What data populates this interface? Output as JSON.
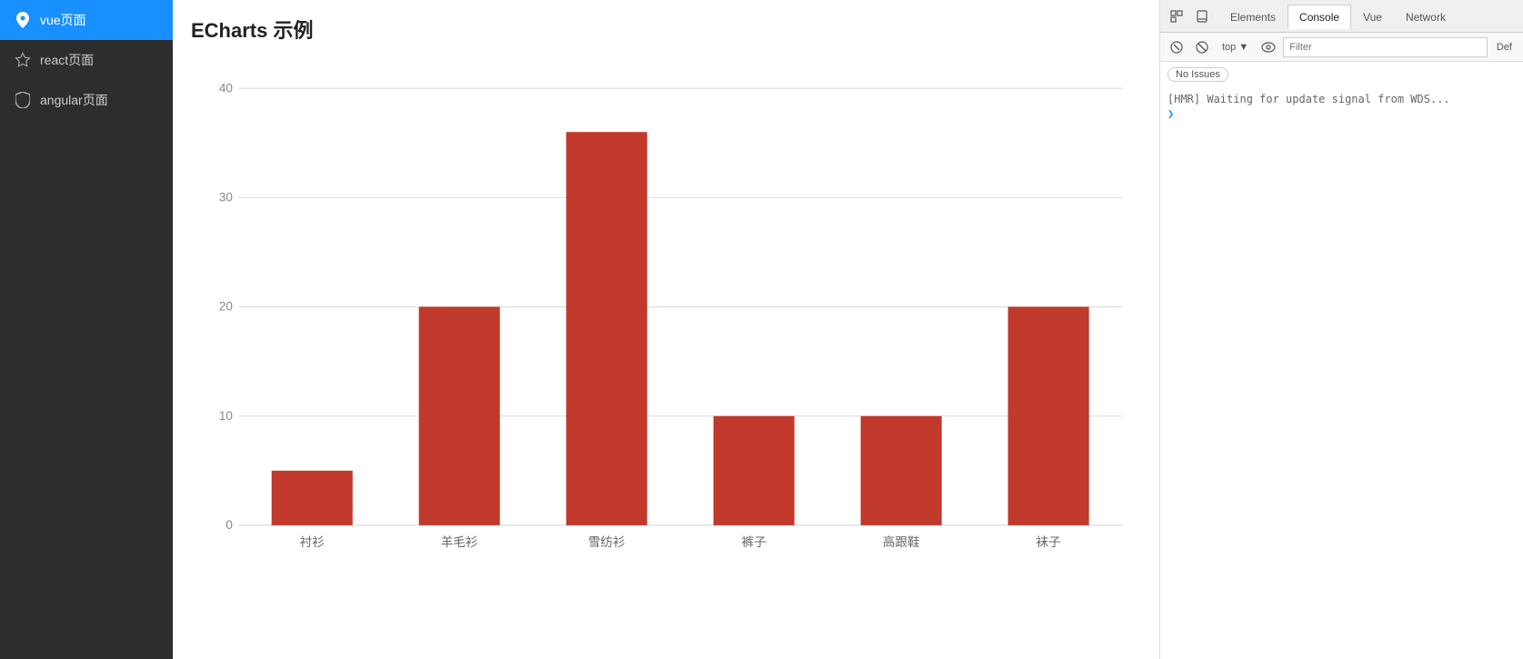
{
  "sidebar": {
    "items": [
      {
        "id": "vue",
        "label": "vue页面",
        "icon": "location-pin",
        "active": true
      },
      {
        "id": "react",
        "label": "react页面",
        "icon": "star",
        "active": false
      },
      {
        "id": "angular",
        "label": "angular页面",
        "icon": "shield",
        "active": false
      }
    ]
  },
  "main": {
    "title": "ECharts 示例"
  },
  "chart": {
    "yAxisMax": 40,
    "yAxisTicks": [
      0,
      10,
      20,
      30,
      40
    ],
    "barColor": "#c0392b",
    "bars": [
      {
        "label": "衬衫",
        "value": 5
      },
      {
        "label": "羊毛衫",
        "value": 20
      },
      {
        "label": "雪纺衫",
        "value": 36
      },
      {
        "label": "裤子",
        "value": 10
      },
      {
        "label": "高跟鞋",
        "value": 10
      },
      {
        "label": "袜子",
        "value": 20
      }
    ]
  },
  "devtools": {
    "tabs": [
      {
        "id": "elements",
        "label": "Elements",
        "active": false
      },
      {
        "id": "console",
        "label": "Console",
        "active": true
      },
      {
        "id": "vue",
        "label": "Vue",
        "active": false
      },
      {
        "id": "network",
        "label": "Network",
        "active": false
      }
    ],
    "toolbar": {
      "top_label": "top ▼",
      "filter_placeholder": "Filter",
      "def_label": "Def"
    },
    "no_issues": "No Issues",
    "console_messages": [
      "[HMR] Waiting for update signal from WDS..."
    ]
  }
}
